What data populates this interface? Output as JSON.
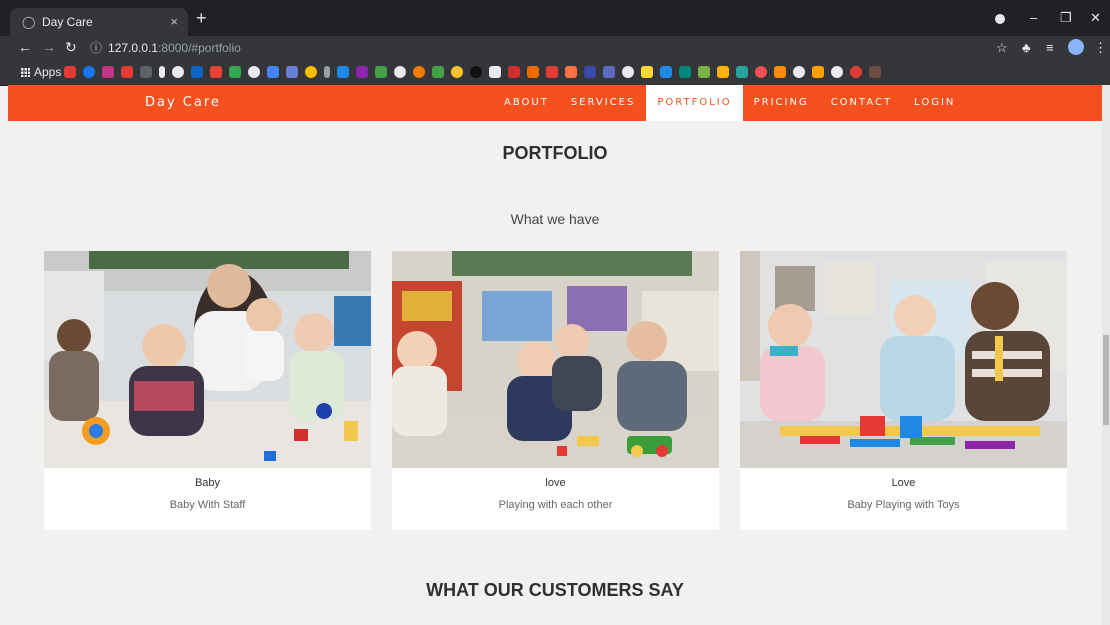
{
  "browser": {
    "tab_title": "Day Care",
    "close_glyph": "×",
    "new_tab_glyph": "+",
    "url_host": "127.0.0.1",
    "url_path": ":8000/#portfolio",
    "bookmarks_apps_label": "Apps"
  },
  "navbar": {
    "brand": "Day Care",
    "links": [
      "ABOUT",
      "SERVICES",
      "PORTFOLIO",
      "PRICING",
      "CONTACT",
      "LOGIN"
    ],
    "active_link": "PORTFOLIO",
    "accent_color": "#f4511e"
  },
  "portfolio": {
    "title": "PORTFOLIO",
    "subtitle": "What we have",
    "cards": [
      {
        "name": "Baby",
        "description": "Baby With Staff"
      },
      {
        "name": "love",
        "description": "Playing with each other"
      },
      {
        "name": "Love",
        "description": "Baby Playing with Toys"
      }
    ]
  },
  "testimonials": {
    "title": "WHAT OUR CUSTOMERS SAY"
  }
}
